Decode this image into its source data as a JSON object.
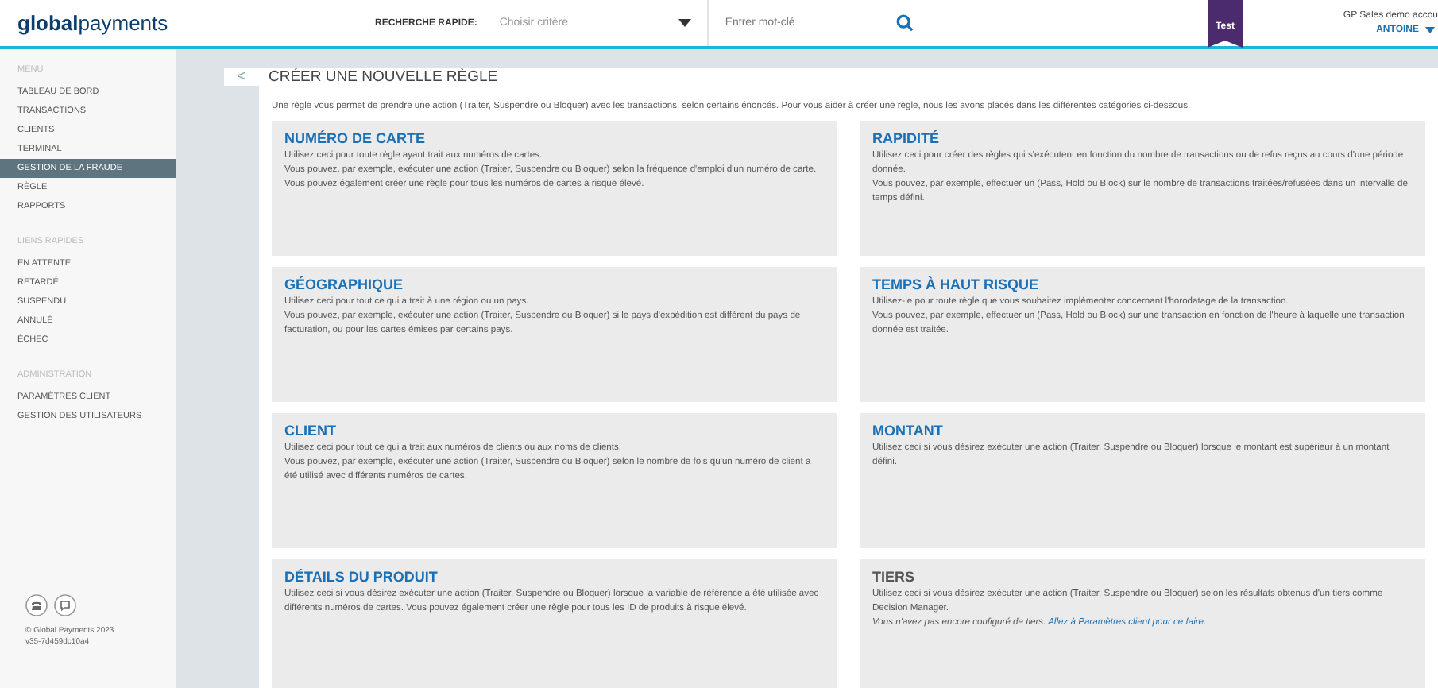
{
  "header": {
    "logo": "**global**payments",
    "search_label": "RECHERCHE RAPIDE:",
    "criteria_placeholder": "Choisir critère",
    "keyword_placeholder": "Entrer mot-clé",
    "badge": "Test",
    "account": "GP Sales demo accou",
    "user": "ANTOINE"
  },
  "sidebar": {
    "sections": [
      {
        "heading": "MENU",
        "items": [
          {
            "label": "TABLEAU DE BORD",
            "selected": false
          },
          {
            "label": "TRANSACTIONS",
            "selected": false
          },
          {
            "label": "CLIENTS",
            "selected": false
          },
          {
            "label": "TERMINAL",
            "selected": false
          },
          {
            "label": "GESTION DE LA FRAUDE",
            "selected": true
          },
          {
            "label": "RÈGLE",
            "selected": false
          },
          {
            "label": "RAPPORTS",
            "selected": false
          }
        ]
      },
      {
        "heading": "LIENS RAPIDES",
        "items": [
          {
            "label": "EN ATTENTE",
            "selected": false
          },
          {
            "label": "RETARDÉ",
            "selected": false
          },
          {
            "label": "SUSPENDU",
            "selected": false
          },
          {
            "label": "ANNULÉ",
            "selected": false
          },
          {
            "label": "ÉCHEC",
            "selected": false
          }
        ]
      },
      {
        "heading": "ADMINISTRATION",
        "items": [
          {
            "label": "PARAMÈTRES CLIENT",
            "selected": false
          },
          {
            "label": "GESTION DES UTILISATEURS",
            "selected": false
          }
        ]
      }
    ],
    "copyright": "© Global Payments 2023",
    "version": "v35-7d459dc10a4"
  },
  "page": {
    "back": "<",
    "title": "CRÉER UNE NOUVELLE RÈGLE",
    "intro": "Une règle vous permet de prendre une action (Traiter, Suspendre ou Bloquer) avec les transactions, selon certains énoncés. Pour vous aider à créer une règle, nous les avons placés dans les différentes catégories ci-dessous.",
    "cards": [
      {
        "title": "NUMÉRO DE CARTE",
        "disabled": false,
        "paragraphs": [
          "Utilisez ceci pour toute règle ayant trait aux numéros de cartes.",
          "Vous pouvez, par exemple, exécuter une action (Traiter, Suspendre ou Bloquer) selon la fréquence d'emploi d'un numéro de carte. Vous pouvez également créer une règle pour tous les numéros de cartes à risque élevé."
        ]
      },
      {
        "title": "RAPIDITÉ",
        "disabled": false,
        "paragraphs": [
          "Utilisez ceci pour créer des règles qui s'exécutent en fonction du nombre de transactions ou de refus reçus au cours d'une période donnée.",
          "Vous pouvez, par exemple, effectuer un (Pass, Hold ou Block) sur le nombre de transactions traitées/refusées dans un intervalle de temps défini."
        ]
      },
      {
        "title": "GÉOGRAPHIQUE",
        "disabled": false,
        "paragraphs": [
          "Utilisez ceci pour tout ce qui a trait à une région ou un pays.",
          "Vous pouvez, par exemple, exécuter une action (Traiter, Suspendre ou Bloquer) si le pays d'expédition est différent du pays de facturation, ou pour les cartes émises par certains pays."
        ]
      },
      {
        "title": "TEMPS À HAUT RISQUE",
        "disabled": false,
        "paragraphs": [
          "Utilisez-le pour toute règle que vous souhaitez implémenter concernant l'horodatage de la transaction.",
          "Vous pouvez, par exemple, effectuer un (Pass, Hold ou Block) sur une transaction en fonction de l'heure à laquelle une transaction donnée est traitée."
        ]
      },
      {
        "title": "CLIENT",
        "disabled": false,
        "paragraphs": [
          "Utilisez ceci pour tout ce qui a trait aux numéros de clients ou aux noms de clients.",
          "Vous pouvez, par exemple, exécuter une action (Traiter, Suspendre ou Bloquer) selon le nombre de fois qu'un numéro de client a été utilisé avec différents numéros de cartes."
        ]
      },
      {
        "title": "MONTANT",
        "disabled": false,
        "paragraphs": [
          "Utilisez ceci si vous désirez exécuter une action (Traiter, Suspendre ou Bloquer) lorsque le montant est supérieur à un montant défini."
        ]
      },
      {
        "title": "DÉTAILS DU PRODUIT",
        "disabled": false,
        "paragraphs": [
          "Utilisez ceci si vous désirez exécuter une action (Traiter, Suspendre ou Bloquer) lorsque la variable de référence a été utilisée avec différents numéros de cartes. Vous pouvez également créer une règle pour tous les ID de produits à risque élevé."
        ]
      },
      {
        "title": "TIERS",
        "disabled": true,
        "paragraphs": [
          "Utilisez ceci si vous désirez exécuter une action (Traiter, Suspendre ou Bloquer) selon les résultats obtenus d'un tiers comme Decision Manager."
        ],
        "note": "Vous n'avez pas encore configuré de tiers.",
        "link": "Allez à Paramètres client pour ce faire."
      }
    ]
  }
}
